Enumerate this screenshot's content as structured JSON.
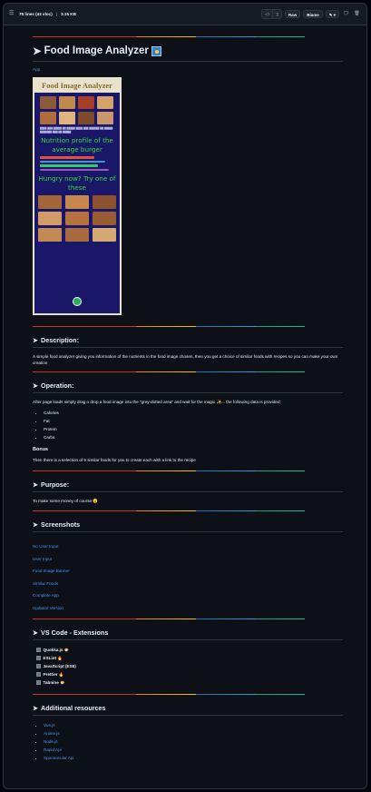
{
  "toolbar": {
    "lines": "78 lines (42 sloc)",
    "size": "3.15 KB",
    "raw_label": "Raw",
    "blame_label": "Blame"
  },
  "title": "Food Image Analyzer",
  "app_link": "App",
  "preview": {
    "header": "Food Image Analyzer",
    "nutrition_heading": "Nutrition profile of the average burger",
    "hungry_heading": "Hungry now? Try one of these"
  },
  "description": {
    "heading": "Description:",
    "text": "A simple food analyzer giving you information of the nutrients in the food image chosen, then you get a choice of similar foods with recipes so you can make your own creation"
  },
  "operation": {
    "heading": "Operation:",
    "text": "After page loads simply drag n drop a food image into the \"grey-dotted area\" and wait for the magic ✨... the following data is provided:",
    "items": [
      "Calories",
      "Fat",
      "Protein",
      "Carbs"
    ],
    "bonus_heading": "Bonus",
    "bonus_text": "Then there is a selection of 9 similar foods for you to create each with a link to the recipe"
  },
  "purpose": {
    "heading": "Purpose:",
    "text": "To make some money of course 😉"
  },
  "screenshots": {
    "heading": "Screenshots",
    "links": [
      "No User Input",
      "User Input",
      "Food Image Banner",
      "Similar Foods",
      "Complete App",
      "Updated Version"
    ]
  },
  "vscode": {
    "heading": "VS Code - Extensions",
    "items": [
      "Quokka.js 🐡",
      "ESLint 🔥",
      "JavaScript (ES6)",
      "Prettier 🔥",
      "Tabnine 🐡"
    ]
  },
  "resources": {
    "heading": "Additional resources",
    "links": [
      "Vue.js",
      "Anime.js",
      "Node.js",
      "Rapid Api",
      "Spoonacular Api"
    ]
  }
}
